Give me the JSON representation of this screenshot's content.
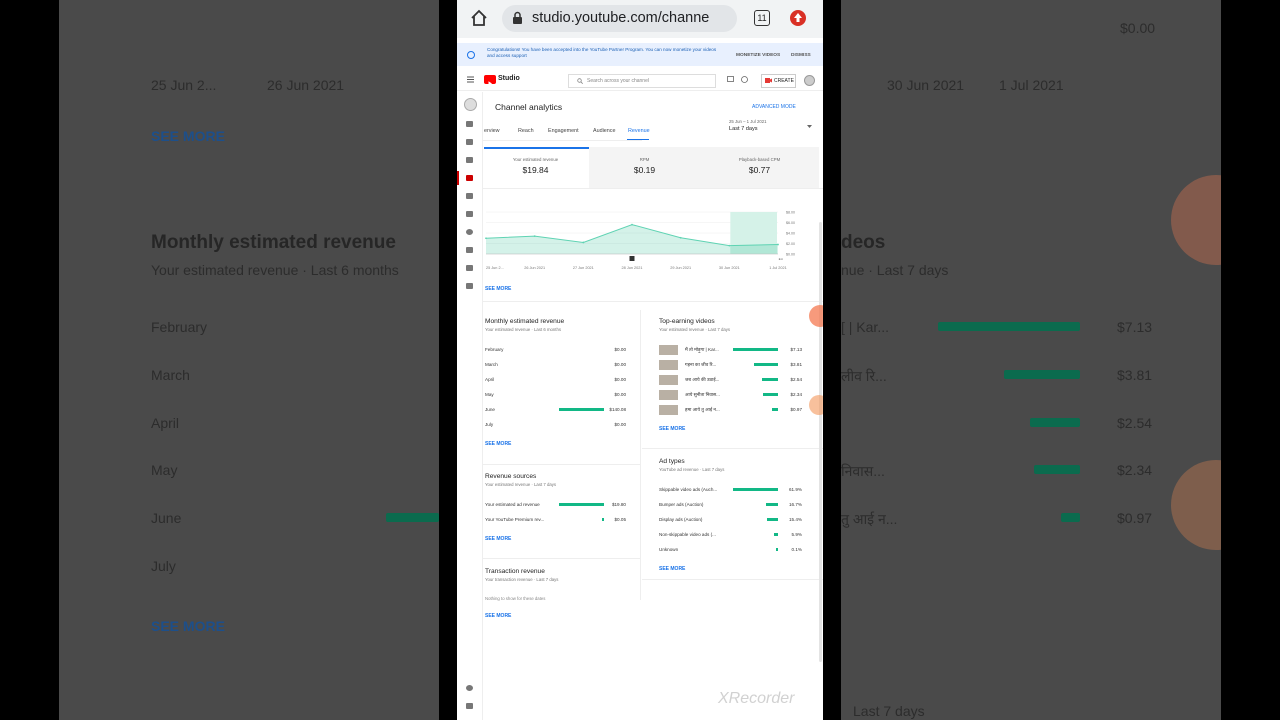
{
  "browser": {
    "url": "studio.youtube.com/channe",
    "tab_count": "11"
  },
  "banner": {
    "message": "Congratulations! You have been accepted into the YouTube Partner Program. You can now monetize your videos and access support",
    "monetize_label": "MONETIZE VIDEOS",
    "dismiss_label": "DISMISS"
  },
  "topbar": {
    "brand": "Studio",
    "search_placeholder": "Search across your channel",
    "create_label": "CREATE"
  },
  "analytics": {
    "title": "Channel analytics",
    "advanced_mode": "ADVANCED MODE",
    "tabs": [
      "erview",
      "Reach",
      "Engagement",
      "Audience",
      "Revenue"
    ],
    "active_tab": "Revenue",
    "date_range_small": "25 Jun – 1 Jul 2021",
    "date_range": "Last 7 days"
  },
  "metrics": [
    {
      "label": "Your estimated revenue",
      "value": "$19.84"
    },
    {
      "label": "RPM",
      "value": "$0.19"
    },
    {
      "label": "Playback-based CPM",
      "value": "$0.77"
    }
  ],
  "chart_data": {
    "type": "area",
    "x": [
      "25 Jun 2...",
      "26 Jun 2021",
      "27 Jun 2021",
      "28 Jun 2021",
      "29 Jun 2021",
      "30 Jun 2021",
      "1 Jul 2021"
    ],
    "values": [
      3.0,
      3.4,
      2.2,
      5.6,
      3.1,
      1.6,
      1.8
    ],
    "y_ticks": [
      "$8.00",
      "$6.00",
      "$4.00",
      "$2.00",
      "$0.00"
    ],
    "ylim": [
      0,
      8
    ]
  },
  "overview_see_more": "SEE MORE",
  "monthly": {
    "title": "Monthly estimated revenue",
    "subtitle": "Your estimated revenue · Last 6 months",
    "rows": [
      {
        "month": "February",
        "value": "$0.00",
        "amount": 0
      },
      {
        "month": "March",
        "value": "$0.00",
        "amount": 0
      },
      {
        "month": "April",
        "value": "$0.00",
        "amount": 0
      },
      {
        "month": "May",
        "value": "$0.00",
        "amount": 0
      },
      {
        "month": "June",
        "value": "$140.08",
        "amount": 140.08
      },
      {
        "month": "July",
        "value": "$0.00",
        "amount": 0
      }
    ],
    "see_more": "SEE MORE"
  },
  "top_videos": {
    "title": "Top-earning videos",
    "subtitle": "Your estimated revenue · Last 7 days",
    "rows": [
      {
        "name": "मैं तो मोड़ूगा | Kar...",
        "value": "$7.13",
        "amount": 7.13
      },
      {
        "name": "गहना का जीव रि...",
        "value": "$3.81",
        "amount": 3.81
      },
      {
        "name": "जब आये की उठाई...",
        "value": "$2.54",
        "amount": 2.54
      },
      {
        "name": "आये सुनीता निवास...",
        "value": "$2.34",
        "amount": 2.34
      },
      {
        "name": "हमा आये तु आई न...",
        "value": "$0.97",
        "amount": 0.97
      }
    ],
    "see_more": "SEE MORE"
  },
  "revenue_sources": {
    "title": "Revenue sources",
    "subtitle": "Your estimated revenue · Last 7 days",
    "rows": [
      {
        "name": "Your estimated ad revenue",
        "value": "$19.80",
        "amount": 19.8
      },
      {
        "name": "Your YouTube Premium rev...",
        "value": "$0.05",
        "amount": 0.05
      }
    ],
    "see_more": "SEE MORE"
  },
  "ad_types": {
    "title": "Ad types",
    "subtitle": "YouTube ad revenue · Last 7 days",
    "rows": [
      {
        "name": "Skippable video ads (Auch...",
        "value": "61.9%",
        "amount": 61.9
      },
      {
        "name": "Bumper ads (Auction)",
        "value": "16.7%",
        "amount": 16.7
      },
      {
        "name": "Display ads (Auction)",
        "value": "15.4%",
        "amount": 15.4
      },
      {
        "name": "Non-skippable video ads (...",
        "value": "5.9%",
        "amount": 5.9
      },
      {
        "name": "Unknown",
        "value": "0.1%",
        "amount": 0.1
      }
    ],
    "see_more": "SEE MORE"
  },
  "transaction": {
    "title": "Transaction revenue",
    "subtitle": "Your transaction revenue · Last 7 days",
    "empty": "Nothing to show for these dates",
    "see_more": "SEE MORE"
  },
  "background": {
    "see_more": "SEE MORE",
    "monthly_title": "Monthly estimated revenue",
    "monthly_sub": "Your estimated revenue · Last 6 months",
    "months": [
      "February",
      "March",
      "April",
      "May",
      "June",
      "July"
    ],
    "dates_left": [
      "25 Jun 2...",
      "26 Jun 2021"
    ],
    "dates_right": [
      "30 Jun 2021",
      "1 Jul 2021"
    ],
    "right_title": "deos",
    "right_sub": "nue · Last 7 days",
    "right_values": [
      "$7.13",
      "$3.81",
      "$2.54",
      "$2.34",
      "$0.97"
    ],
    "right_names": [
      "[ | Kar...",
      "लीव रि...",
      "",
      "निवास...",
      "तु आई न..."
    ],
    "right_top_value": "$0.00",
    "right_bottom": "Last 7 days"
  },
  "watermark": "XRecorder",
  "colors": {
    "accent": "#1a73e8",
    "bar": "#12b886",
    "youtube_red": "#ff0000"
  }
}
